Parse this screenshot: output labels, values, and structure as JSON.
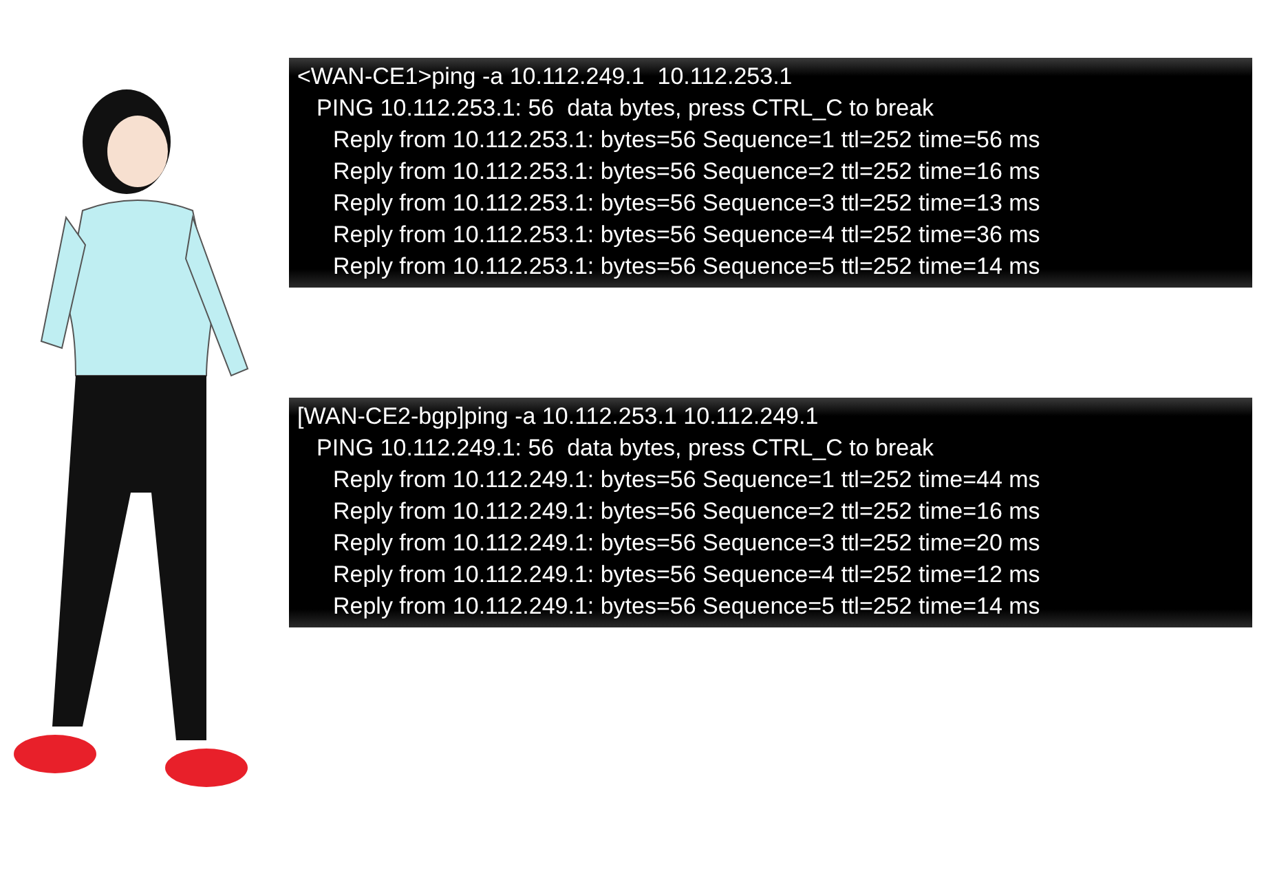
{
  "terminals": [
    {
      "lines": [
        {
          "kind": "command",
          "text": "<WAN-CE1>ping -a 10.112.249.1  10.112.253.1"
        },
        {
          "kind": "header",
          "text": "PING 10.112.253.1: 56  data bytes, press CTRL_C to break"
        },
        {
          "kind": "reply",
          "text": "Reply from 10.112.253.1: bytes=56 Sequence=1 ttl=252 time=56 ms"
        },
        {
          "kind": "reply",
          "text": "Reply from 10.112.253.1: bytes=56 Sequence=2 ttl=252 time=16 ms"
        },
        {
          "kind": "reply",
          "text": "Reply from 10.112.253.1: bytes=56 Sequence=3 ttl=252 time=13 ms"
        },
        {
          "kind": "reply",
          "text": "Reply from 10.112.253.1: bytes=56 Sequence=4 ttl=252 time=36 ms"
        },
        {
          "kind": "reply",
          "text": "Reply from 10.112.253.1: bytes=56 Sequence=5 ttl=252 time=14 ms"
        }
      ]
    },
    {
      "lines": [
        {
          "kind": "command",
          "text": "[WAN-CE2-bgp]ping -a 10.112.253.1 10.112.249.1"
        },
        {
          "kind": "header",
          "text": "PING 10.112.249.1: 56  data bytes, press CTRL_C to break"
        },
        {
          "kind": "reply",
          "text": "Reply from 10.112.249.1: bytes=56 Sequence=1 ttl=252 time=44 ms"
        },
        {
          "kind": "reply",
          "text": "Reply from 10.112.249.1: bytes=56 Sequence=2 ttl=252 time=16 ms"
        },
        {
          "kind": "reply",
          "text": "Reply from 10.112.249.1: bytes=56 Sequence=3 ttl=252 time=20 ms"
        },
        {
          "kind": "reply",
          "text": "Reply from 10.112.249.1: bytes=56 Sequence=4 ttl=252 time=12 ms"
        },
        {
          "kind": "reply",
          "text": "Reply from 10.112.249.1: bytes=56 Sequence=5 ttl=252 time=14 ms"
        }
      ]
    }
  ]
}
